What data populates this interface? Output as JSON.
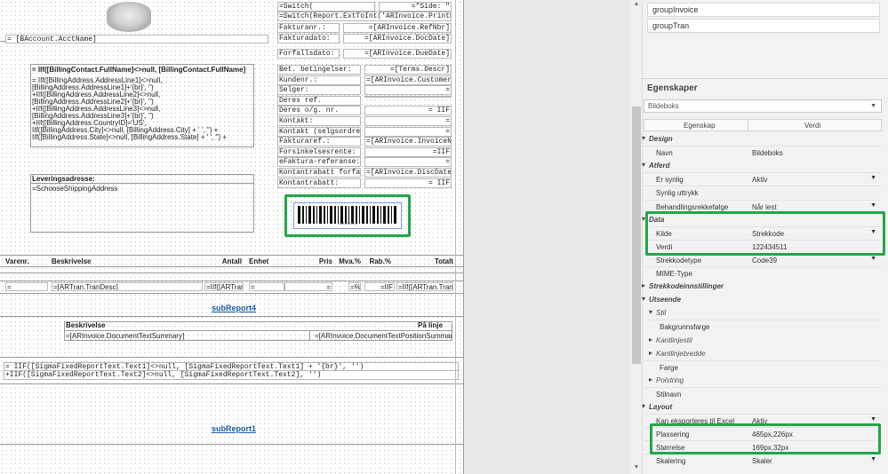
{
  "designer": {
    "header_fields": [
      "=Switch(",
      "=\"Side: \"",
      "=Switch(Report.ExtToInt('ARInvoice.PrintDocType'",
      "Fakturanr.:",
      "=[ARInvoice.RefNbr]",
      "Fakturadato:",
      "=[ARInvoice.DocDate]",
      "Forfallsdato:",
      "=[ARInvoice.DueDate]"
    ],
    "account_field": "= [BAccount.AcctName]",
    "billing_name": "= IIf([BillingContact.FullName]<>null,     [BillingContact.FullName], '')",
    "billing_address": [
      "= IIf([BillingAddress.AddressLine1]<>null,",
      "[BillingAddress.AddressLine1]+'{br}', '')",
      "+IIf([BillingAddress.AddressLine2]<>null,",
      "[BillingAddress.AddressLine2]+'{br}', '')",
      "+IIf([BillingAddress.AddressLine3]<>null,",
      "[BillingAddress.AddressLine3]+'{br}', '')",
      "+IIf([BillingAddress.CountryID]='US',",
      "      IIf([BillingAddress.City]<>null, [BillingAddress.City] + ' ', '') +",
      "IIf([BillingAddress.State]<>null, [BillingAddress.State] + ' ', '') +"
    ],
    "info_rows": [
      {
        "label": "Bet. betingelser:",
        "value": "=[Terms.Descr]"
      },
      {
        "label": "Kundenr.:",
        "value": "=[ARInvoice.CustomerID]"
      },
      {
        "label": "Selger:",
        "value": "="
      },
      {
        "label": "Deres ref.",
        "value": ""
      },
      {
        "label": "Deres o/g. nr.",
        "value": "= IIF"
      },
      {
        "label": "Kontakt:",
        "value": "="
      },
      {
        "label": "Kontakt (selgsordre):",
        "value": "="
      },
      {
        "label": "Fakturaref.:",
        "value": "=[ARInvoice.InvoiceNbr]"
      },
      {
        "label": "Forsinkelsesrente:",
        "value": "=IIF"
      },
      {
        "label": "eFaktura-referanse:",
        "value": "="
      },
      {
        "label": "Kontantrabatt forfall:",
        "value": "=[ARInvoice.DiscDate]"
      },
      {
        "label": "Kontantrabatt:",
        "value": "= IIF"
      }
    ],
    "delivery_label": "Leveringsadresse:",
    "delivery_field": "=SchooseShippingAddress",
    "barcode_caption": "122434511",
    "columns": [
      "Varenr.",
      "Beskrivelse",
      "Antall",
      "Enhet",
      "Pris",
      "Mva.%",
      "Rab.%",
      "Totalt"
    ],
    "detail_fields": [
      "=",
      "=[ARTran.TranDesc]",
      "=IIf([ARTran",
      "=",
      "=",
      "=%",
      "=IIF",
      "=IIf([ARTran.Tran"
    ],
    "subreport4": "subReport4",
    "desc_header": "Beskrivelse",
    "desc_right": "På linje",
    "desc_field": "=[ARInvoice.DocumentTextSummary]",
    "desc_field2": "=[ARInvoice.DocumentTextPositionSummary]",
    "sigma1": "= IIF([SigmaFixedReportText.Text1]<>null, [SigmaFixedReportText.Text1] + '{br}', '')",
    "sigma2": " +IIF([SigmaFixedReportText.Text2]<>null, [SigmaFixedReportText.Text2], '')",
    "subreport1": "subReport1"
  },
  "panel": {
    "groups": [
      "groupInvoice",
      "groupTran"
    ],
    "title": "Egenskaper",
    "selector": "Bildeboks",
    "col_property": "Egenskap",
    "col_value": "Verdi",
    "rows": [
      {
        "type": "cat",
        "key": "Design"
      },
      {
        "type": "prop",
        "key": "Navn",
        "value": "Bildeboks"
      },
      {
        "type": "cat",
        "key": "Atferd"
      },
      {
        "type": "prop",
        "key": "Er synlig",
        "value": "Aktiv",
        "dropdown": true
      },
      {
        "type": "prop",
        "key": "Synlig uttrykk",
        "value": ""
      },
      {
        "type": "prop",
        "key": "Behandlingsrekkefølge",
        "value": "Når lest",
        "dropdown": true
      },
      {
        "type": "cat",
        "key": "Data"
      },
      {
        "type": "prop",
        "key": "Kilde",
        "value": "Strekkode",
        "dropdown": true
      },
      {
        "type": "prop",
        "key": "Verdi",
        "value": "122434511"
      },
      {
        "type": "prop",
        "key": "Strekkodetype",
        "value": "Code39",
        "dropdown": true
      },
      {
        "type": "prop",
        "key": "MIME-Type",
        "value": ""
      },
      {
        "type": "cat",
        "key": "Strekkodeinnstillinger"
      },
      {
        "type": "cat",
        "key": "Utseende"
      },
      {
        "type": "sub",
        "key": "Stil"
      },
      {
        "type": "prop2",
        "key": "Bakgrunnsfarge",
        "value": ""
      },
      {
        "type": "subi",
        "key": "Kantlinjestil"
      },
      {
        "type": "subi",
        "key": "Kantlinjebredde"
      },
      {
        "type": "prop2",
        "key": "Farge",
        "value": ""
      },
      {
        "type": "subi",
        "key": "Polstring"
      },
      {
        "type": "prop",
        "key": "Stilnavn",
        "value": ""
      },
      {
        "type": "cat",
        "key": "Layout"
      },
      {
        "type": "prop",
        "key": "Kan eksporteres til Excel",
        "value": "Aktiv",
        "dropdown": true
      },
      {
        "type": "prop",
        "key": "Plassering",
        "value": "465px,226px"
      },
      {
        "type": "prop",
        "key": "Størrelse",
        "value": "169px,32px"
      },
      {
        "type": "prop",
        "key": "Skalering",
        "value": "Skaler",
        "dropdown": true
      }
    ]
  },
  "colors": {
    "highlight": "#22a64a",
    "link": "#1a5aa0"
  }
}
